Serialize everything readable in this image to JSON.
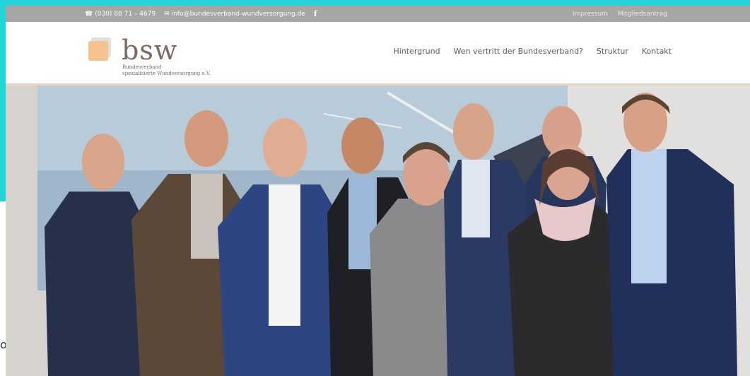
{
  "topbar": {
    "phone": "(030) 88 71 – 4679",
    "email": "info@bundesverband-wundversorgung.de",
    "facebook_icon": "f",
    "links": [
      "Impressum",
      "Mitgliedsantrag"
    ]
  },
  "logo": {
    "brand": "bsw",
    "subtitle_line1": "Bundesverband",
    "subtitle_line2": "spezialisierte Wundversorgung e.V."
  },
  "nav": {
    "items": [
      "Hintergrund",
      "Wen vertritt der Bundesverband?",
      "Struktur",
      "Kontakt"
    ]
  },
  "edge_text": "o",
  "colors": {
    "topbar_bg": "#a6a6a6",
    "header_accent": "#e7d6c3",
    "logo_orange": "#f5c48e",
    "logo_text": "#7b6b63",
    "frame_teal": "#22d3d8"
  }
}
